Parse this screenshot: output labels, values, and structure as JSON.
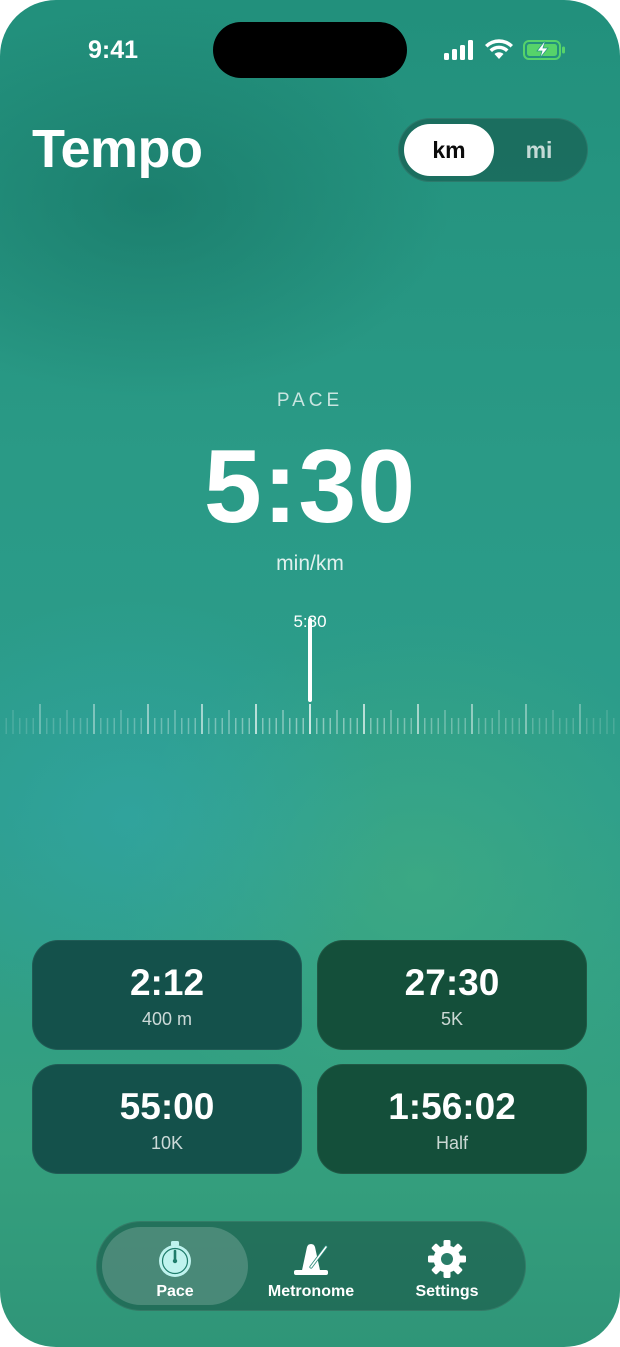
{
  "status": {
    "time": "9:41"
  },
  "header": {
    "title": "Tempo"
  },
  "units": {
    "options": [
      "km",
      "mi"
    ],
    "selected": "km"
  },
  "pace": {
    "label": "PACE",
    "value": "5:30",
    "unit": "min/km",
    "scrubber_label": "5:30"
  },
  "splits": [
    {
      "time": "2:12",
      "distance": "400 m"
    },
    {
      "time": "27:30",
      "distance": "5K"
    },
    {
      "time": "55:00",
      "distance": "10K"
    },
    {
      "time": "1:56:02",
      "distance": "Half"
    }
  ],
  "tabs": [
    {
      "label": "Pace",
      "icon": "stopwatch-icon",
      "active": true
    },
    {
      "label": "Metronome",
      "icon": "metronome-icon",
      "active": false
    },
    {
      "label": "Settings",
      "icon": "gear-icon",
      "active": false
    }
  ],
  "colors": {
    "accent_icon": "#bff3ee",
    "card_teal": "#14514b",
    "card_green": "#144f3a"
  }
}
